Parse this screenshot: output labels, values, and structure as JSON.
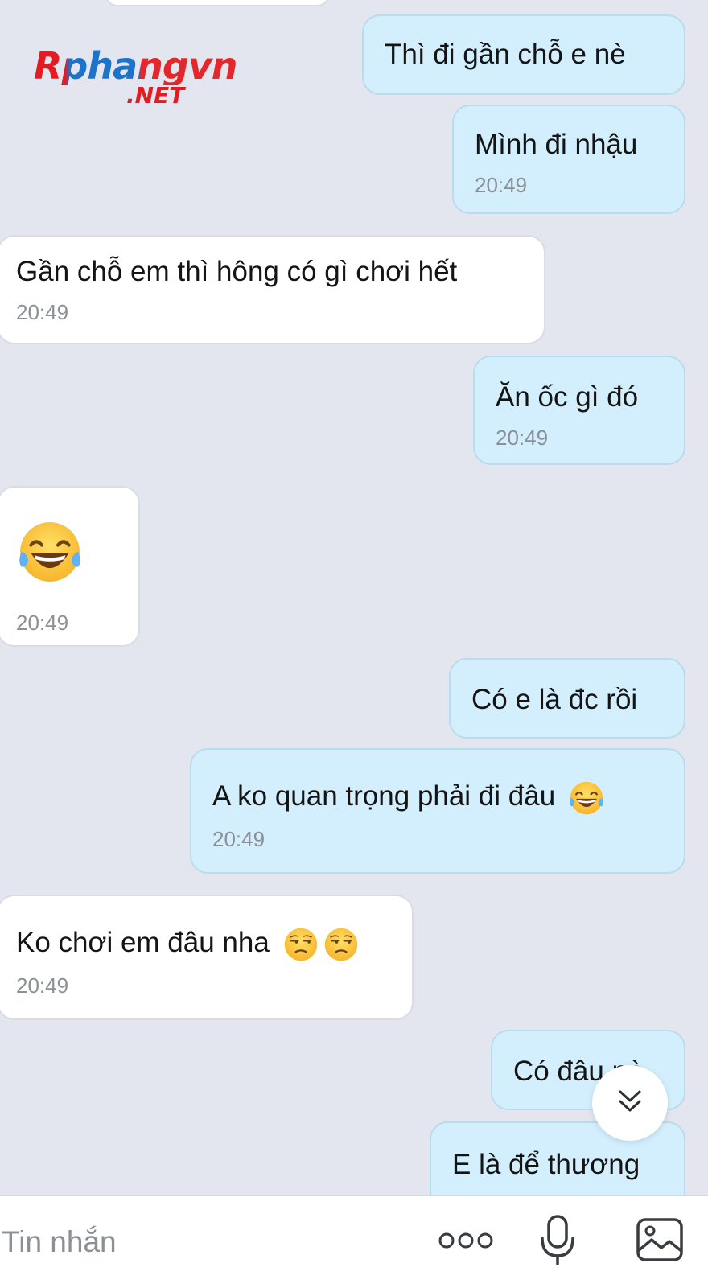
{
  "watermark": {
    "brand": "Rphangvn",
    "suffix": ".NET"
  },
  "messages": [
    {
      "side": "out",
      "text": "Thì đi gần chỗ e nè",
      "time": ""
    },
    {
      "side": "out",
      "text": "Mình đi nhậu",
      "time": "20:49"
    },
    {
      "side": "in",
      "text": "Gần chỗ em thì hông có gì chơi hết",
      "time": "20:49"
    },
    {
      "side": "out",
      "text": "Ăn ốc gì đó",
      "time": "20:49"
    },
    {
      "side": "in",
      "text": "",
      "emoji": "tears-of-joy-emoji",
      "time": "20:49"
    },
    {
      "side": "out",
      "text": "Có e là đc rồi",
      "time": ""
    },
    {
      "side": "out",
      "text": "A ko quan trọng phải đi đâu",
      "emoji": "tears-of-joy-emoji",
      "time": "20:49"
    },
    {
      "side": "in",
      "text": "Ko chơi em đâu nha",
      "emoji": "unamused-face-emoji ×2",
      "time": "20:49"
    },
    {
      "side": "out",
      "text": "Có đâu nè",
      "time": ""
    },
    {
      "side": "out",
      "text": "E là để thương",
      "time": ""
    }
  ],
  "scroll_button": {
    "icon": "double-chevron-down-icon"
  },
  "composer": {
    "placeholder": "Tin nhắn",
    "icons": [
      "more-dots-icon",
      "microphone-icon",
      "image-icon"
    ]
  },
  "colors": {
    "background": "#e3e6ef",
    "outgoing_bubble": "#d3effd",
    "incoming_bubble": "#ffffff",
    "timestamp": "#8b8f96"
  }
}
